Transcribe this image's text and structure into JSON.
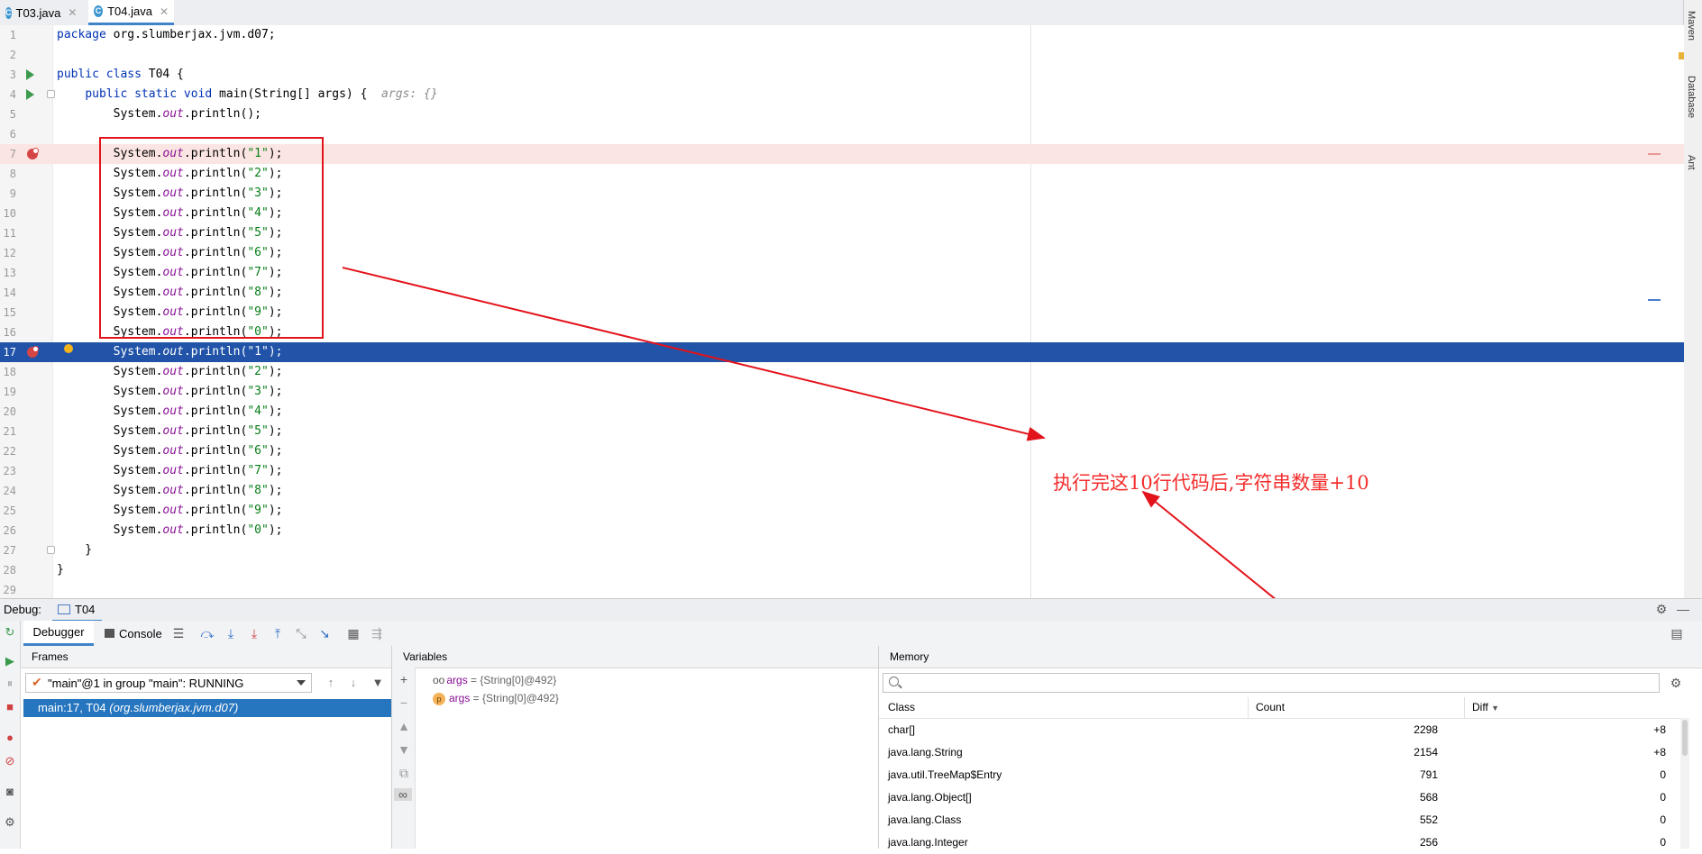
{
  "tabs": [
    {
      "label": "T03.java",
      "active": false
    },
    {
      "label": "T04.java",
      "active": true
    }
  ],
  "right_tools": [
    "Maven",
    "Database",
    "Ant"
  ],
  "editor": {
    "lines": [
      {
        "n": "1",
        "parts": [
          [
            "kw",
            "package "
          ],
          [
            "",
            "org.slumberjax.jvm.d07;"
          ]
        ]
      },
      {
        "n": "2",
        "parts": []
      },
      {
        "n": "3",
        "parts": [
          [
            "kw",
            "public class "
          ],
          [
            "",
            "T04 {"
          ]
        ]
      },
      {
        "n": "4",
        "parts": [
          [
            "",
            "    "
          ],
          [
            "kw",
            "public static void "
          ],
          [
            "",
            "main(String[] args) {  "
          ],
          [
            "hint",
            "args: {}"
          ]
        ]
      },
      {
        "n": "5",
        "parts": [
          [
            "",
            "        System."
          ],
          [
            "fld",
            "out"
          ],
          [
            "",
            ".println();"
          ]
        ]
      },
      {
        "n": "6",
        "parts": []
      },
      {
        "n": "7",
        "parts": [
          [
            "",
            "        System."
          ],
          [
            "fld",
            "out"
          ],
          [
            "",
            ".println("
          ],
          [
            "str",
            "\"1\""
          ],
          [
            "",
            ");"
          ]
        ]
      },
      {
        "n": "8",
        "parts": [
          [
            "",
            "        System."
          ],
          [
            "fld",
            "out"
          ],
          [
            "",
            ".println("
          ],
          [
            "str",
            "\"2\""
          ],
          [
            "",
            ");"
          ]
        ]
      },
      {
        "n": "9",
        "parts": [
          [
            "",
            "        System."
          ],
          [
            "fld",
            "out"
          ],
          [
            "",
            ".println("
          ],
          [
            "str",
            "\"3\""
          ],
          [
            "",
            ");"
          ]
        ]
      },
      {
        "n": "10",
        "parts": [
          [
            "",
            "        System."
          ],
          [
            "fld",
            "out"
          ],
          [
            "",
            ".println("
          ],
          [
            "str",
            "\"4\""
          ],
          [
            "",
            ");"
          ]
        ]
      },
      {
        "n": "11",
        "parts": [
          [
            "",
            "        System."
          ],
          [
            "fld",
            "out"
          ],
          [
            "",
            ".println("
          ],
          [
            "str",
            "\"5\""
          ],
          [
            "",
            ");"
          ]
        ]
      },
      {
        "n": "12",
        "parts": [
          [
            "",
            "        System."
          ],
          [
            "fld",
            "out"
          ],
          [
            "",
            ".println("
          ],
          [
            "str",
            "\"6\""
          ],
          [
            "",
            ");"
          ]
        ]
      },
      {
        "n": "13",
        "parts": [
          [
            "",
            "        System."
          ],
          [
            "fld",
            "out"
          ],
          [
            "",
            ".println("
          ],
          [
            "str",
            "\"7\""
          ],
          [
            "",
            ");"
          ]
        ]
      },
      {
        "n": "14",
        "parts": [
          [
            "",
            "        System."
          ],
          [
            "fld",
            "out"
          ],
          [
            "",
            ".println("
          ],
          [
            "str",
            "\"8\""
          ],
          [
            "",
            ");"
          ]
        ]
      },
      {
        "n": "15",
        "parts": [
          [
            "",
            "        System."
          ],
          [
            "fld",
            "out"
          ],
          [
            "",
            ".println("
          ],
          [
            "str",
            "\"9\""
          ],
          [
            "",
            ");"
          ]
        ]
      },
      {
        "n": "16",
        "parts": [
          [
            "",
            "        System."
          ],
          [
            "fld",
            "out"
          ],
          [
            "",
            ".println("
          ],
          [
            "str",
            "\"0\""
          ],
          [
            "",
            ");"
          ]
        ]
      },
      {
        "n": "17",
        "parts": [
          [
            "",
            "        System."
          ],
          [
            "fld",
            "out"
          ],
          [
            "",
            ".println("
          ],
          [
            "str",
            "\"1\""
          ],
          [
            "",
            ");"
          ]
        ]
      },
      {
        "n": "18",
        "parts": [
          [
            "",
            "        System."
          ],
          [
            "fld",
            "out"
          ],
          [
            "",
            ".println("
          ],
          [
            "str",
            "\"2\""
          ],
          [
            "",
            ");"
          ]
        ]
      },
      {
        "n": "19",
        "parts": [
          [
            "",
            "        System."
          ],
          [
            "fld",
            "out"
          ],
          [
            "",
            ".println("
          ],
          [
            "str",
            "\"3\""
          ],
          [
            "",
            ");"
          ]
        ]
      },
      {
        "n": "20",
        "parts": [
          [
            "",
            "        System."
          ],
          [
            "fld",
            "out"
          ],
          [
            "",
            ".println("
          ],
          [
            "str",
            "\"4\""
          ],
          [
            "",
            ");"
          ]
        ]
      },
      {
        "n": "21",
        "parts": [
          [
            "",
            "        System."
          ],
          [
            "fld",
            "out"
          ],
          [
            "",
            ".println("
          ],
          [
            "str",
            "\"5\""
          ],
          [
            "",
            ");"
          ]
        ]
      },
      {
        "n": "22",
        "parts": [
          [
            "",
            "        System."
          ],
          [
            "fld",
            "out"
          ],
          [
            "",
            ".println("
          ],
          [
            "str",
            "\"6\""
          ],
          [
            "",
            ");"
          ]
        ]
      },
      {
        "n": "23",
        "parts": [
          [
            "",
            "        System."
          ],
          [
            "fld",
            "out"
          ],
          [
            "",
            ".println("
          ],
          [
            "str",
            "\"7\""
          ],
          [
            "",
            ");"
          ]
        ]
      },
      {
        "n": "24",
        "parts": [
          [
            "",
            "        System."
          ],
          [
            "fld",
            "out"
          ],
          [
            "",
            ".println("
          ],
          [
            "str",
            "\"8\""
          ],
          [
            "",
            ");"
          ]
        ]
      },
      {
        "n": "25",
        "parts": [
          [
            "",
            "        System."
          ],
          [
            "fld",
            "out"
          ],
          [
            "",
            ".println("
          ],
          [
            "str",
            "\"9\""
          ],
          [
            "",
            ");"
          ]
        ]
      },
      {
        "n": "26",
        "parts": [
          [
            "",
            "        System."
          ],
          [
            "fld",
            "out"
          ],
          [
            "",
            ".println("
          ],
          [
            "str",
            "\"0\""
          ],
          [
            "",
            ");"
          ]
        ]
      },
      {
        "n": "27",
        "parts": [
          [
            "",
            "    }"
          ]
        ]
      },
      {
        "n": "28",
        "parts": [
          [
            "",
            "}"
          ]
        ]
      },
      {
        "n": "29",
        "parts": []
      }
    ],
    "run_markers": [
      "3",
      "4"
    ],
    "breakpoints": [
      "7",
      "17"
    ],
    "current_line": "17",
    "highlighted_bp_line": "7",
    "annotation": "执行完这10行代码后,字符串数量+10"
  },
  "debug": {
    "label": "Debug:",
    "session": "T04",
    "tabs": {
      "debugger": "Debugger",
      "console": "Console"
    },
    "frames": {
      "title": "Frames",
      "thread": "\"main\"@1 in group \"main\": RUNNING",
      "frame_location": "main:17, T04 ",
      "frame_package": "(org.slumberjax.jvm.d07)"
    },
    "variables": {
      "title": "Variables",
      "rows": [
        {
          "name": "args",
          "value": " = {String[0]@492}",
          "icon": "watch-icon"
        },
        {
          "name": "args",
          "value": " = {String[0]@492}",
          "icon": "parameter-icon"
        }
      ]
    },
    "memory": {
      "title": "Memory",
      "search_placeholder": "",
      "columns": {
        "class": "Class",
        "count": "Count",
        "diff": "Diff"
      },
      "rows": [
        {
          "cls": "char[]",
          "cnt": "2298",
          "dif": "+8"
        },
        {
          "cls": "java.lang.String",
          "cnt": "2154",
          "dif": "+8"
        },
        {
          "cls": "java.util.TreeMap$Entry",
          "cnt": "791",
          "dif": "0"
        },
        {
          "cls": "java.lang.Object[]",
          "cnt": "568",
          "dif": "0"
        },
        {
          "cls": "java.lang.Class",
          "cnt": "552",
          "dif": "0"
        },
        {
          "cls": "java.lang.Integer",
          "cnt": "256",
          "dif": "0"
        }
      ]
    }
  },
  "colors": {
    "annotation_red": "#e3131b",
    "current_line": "#2154a8",
    "breakpoint": "#d64545"
  }
}
